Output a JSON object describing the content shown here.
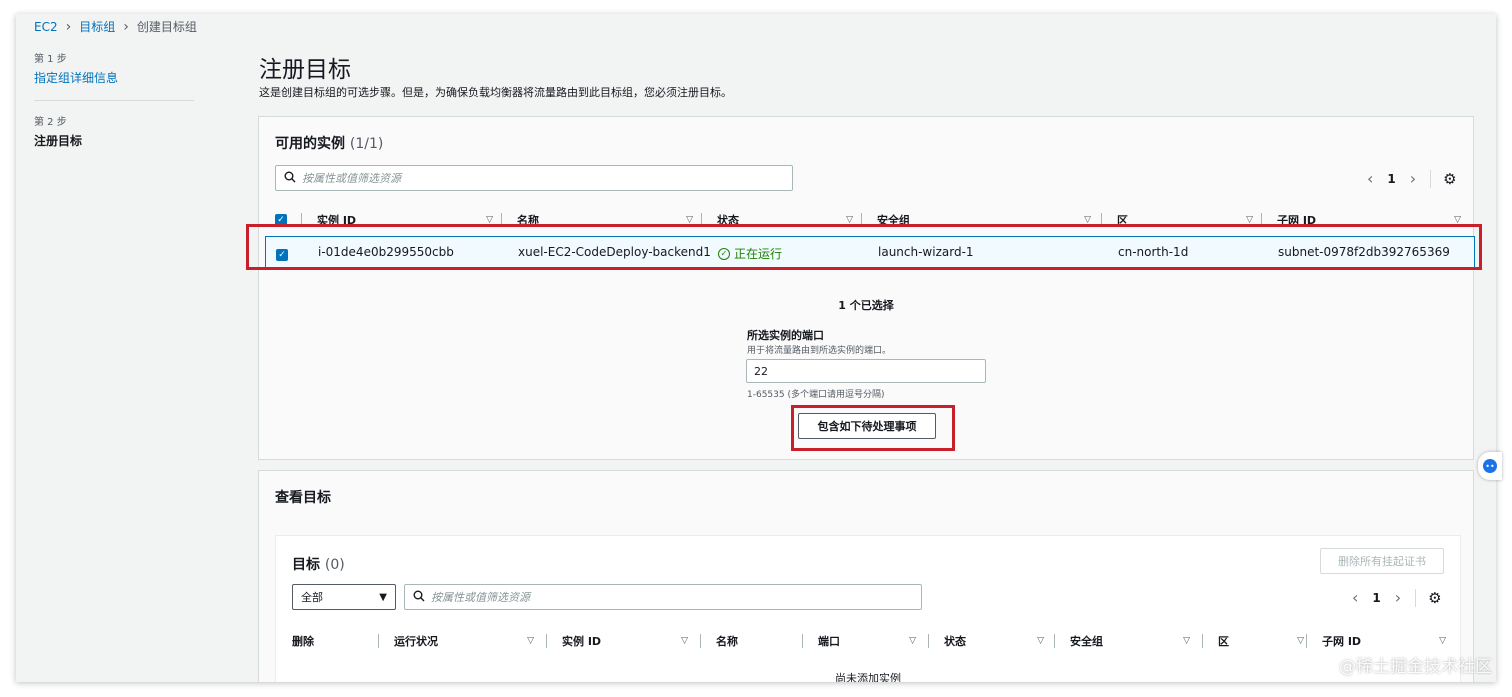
{
  "breadcrumb": {
    "items": [
      "EC2",
      "目标组"
    ],
    "current": "创建目标组"
  },
  "steps": {
    "step1_label": "第 1 步",
    "step1_name": "指定组详细信息",
    "step2_label": "第 2 步",
    "step2_name": "注册目标"
  },
  "page": {
    "title": "注册目标",
    "description": "这是创建目标组的可选步骤。但是，为确保负载均衡器将流量路由到此目标组，您必须注册目标。"
  },
  "instances_panel": {
    "title": "可用的实例",
    "count": "(1/1)",
    "search_placeholder": "按属性或值筛选资源",
    "page": "1",
    "columns": [
      "实例 ID",
      "名称",
      "状态",
      "安全组",
      "区",
      "子网 ID"
    ],
    "row": {
      "instance_id": "i-01de4e0b299550cbb",
      "name": "xuel-EC2-CodeDeploy-backend1",
      "status": "正在运行",
      "security_group": "launch-wizard-1",
      "zone": "cn-north-1d",
      "subnet": "subnet-0978f2db392765369"
    },
    "selected_count": "1 个已选择",
    "port_label": "所选实例的端口",
    "port_desc": "用于将流量路由到所选实例的端口。",
    "port_value": "22",
    "port_hint": "1-65535 (多个端口请用逗号分隔)",
    "include_button": "包含如下待处理事项"
  },
  "review_panel": {
    "title": "查看目标",
    "targets_title": "目标",
    "targets_count": "(0)",
    "remove_all_button": "删除所有挂起证书",
    "filter_value": "全部",
    "search_placeholder": "按属性或值筛选资源",
    "page": "1",
    "columns": [
      "删除",
      "运行状况",
      "实例 ID",
      "名称",
      "端口",
      "状态",
      "安全组",
      "区",
      "子网 ID"
    ],
    "empty_text": "尚未添加实例"
  },
  "watermark": "@稀土掘金技术社区",
  "colors": {
    "link": "#0073bb",
    "highlight": "#c7202b",
    "ok": "#1d8102"
  }
}
